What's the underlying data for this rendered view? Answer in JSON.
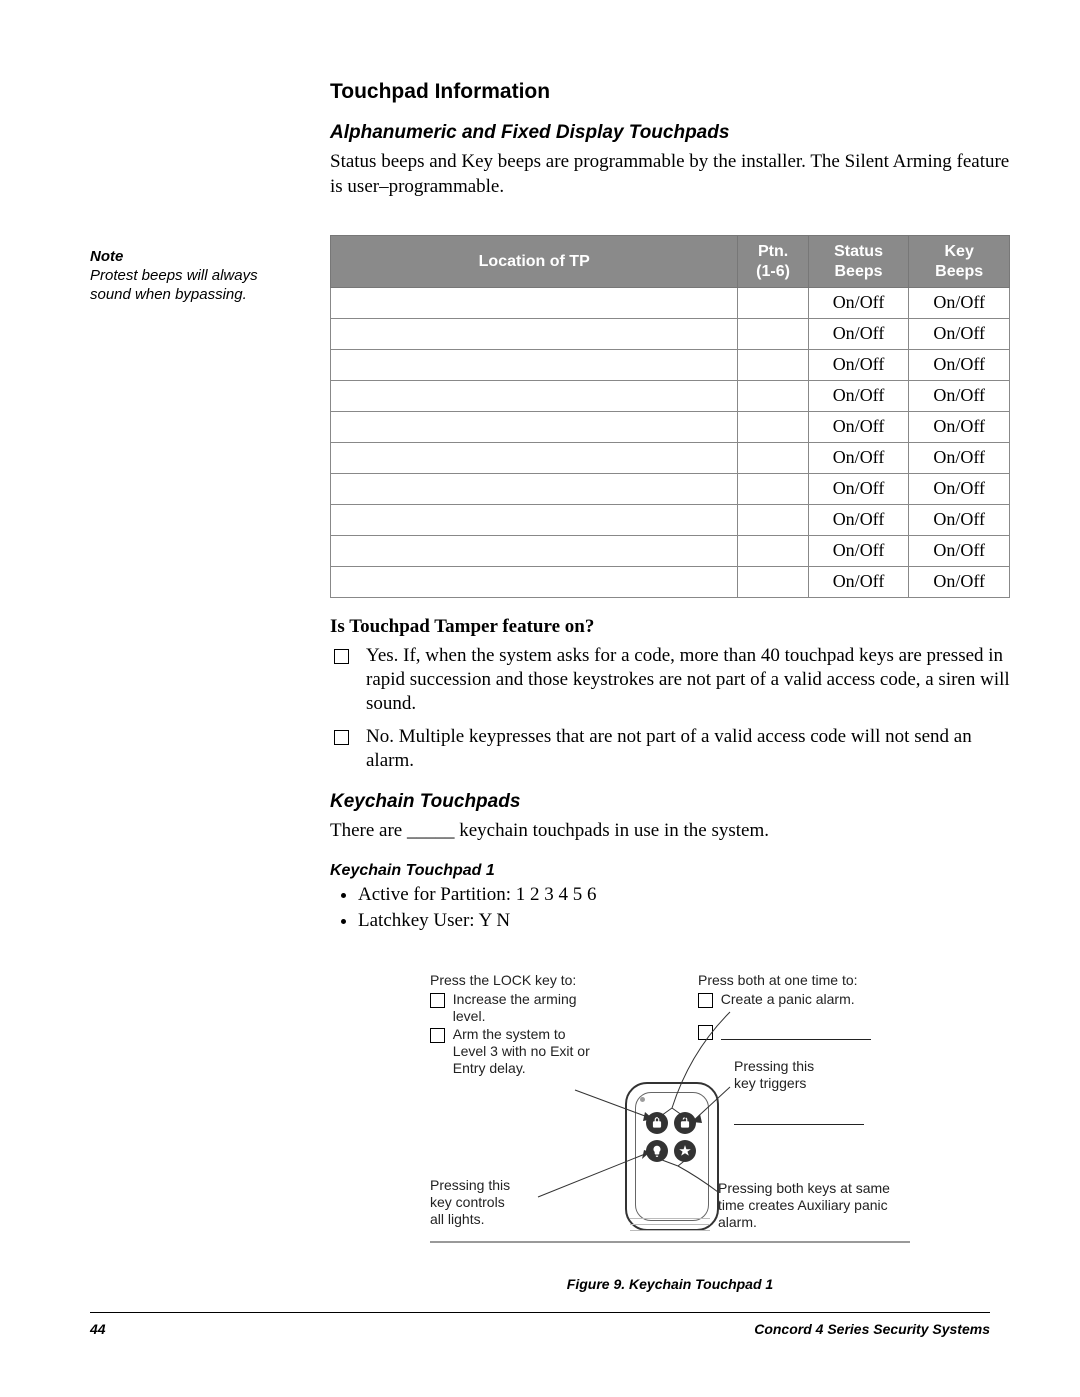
{
  "sidebar": {
    "note_head": "Note",
    "note_body": "Protest beeps will always sound when bypassing."
  },
  "section_title": "Touchpad Information",
  "sub1": {
    "heading": "Alphanumeric and Fixed Display Touchpads",
    "para": "Status beeps and Key beeps are programmable by the installer. The Silent Arming feature is user–programmable."
  },
  "table": {
    "headers": {
      "loc": "Location of TP",
      "ptn_l1": "Ptn.",
      "ptn_l2": "(1-6)",
      "status_l1": "Status",
      "status_l2": "Beeps",
      "key_l1": "Key",
      "key_l2": "Beeps"
    },
    "rows": [
      {
        "loc": "",
        "ptn": "",
        "status": "On/Off",
        "key": "On/Off"
      },
      {
        "loc": "",
        "ptn": "",
        "status": "On/Off",
        "key": "On/Off"
      },
      {
        "loc": "",
        "ptn": "",
        "status": "On/Off",
        "key": "On/Off"
      },
      {
        "loc": "",
        "ptn": "",
        "status": "On/Off",
        "key": "On/Off"
      },
      {
        "loc": "",
        "ptn": "",
        "status": "On/Off",
        "key": "On/Off"
      },
      {
        "loc": "",
        "ptn": "",
        "status": "On/Off",
        "key": "On/Off"
      },
      {
        "loc": "",
        "ptn": "",
        "status": "On/Off",
        "key": "On/Off"
      },
      {
        "loc": "",
        "ptn": "",
        "status": "On/Off",
        "key": "On/Off"
      },
      {
        "loc": "",
        "ptn": "",
        "status": "On/Off",
        "key": "On/Off"
      },
      {
        "loc": "",
        "ptn": "",
        "status": "On/Off",
        "key": "On/Off"
      }
    ]
  },
  "tamper": {
    "question": "Is Touchpad Tamper feature on?",
    "yes": "Yes.  If, when the system asks for a code, more than 40 touchpad keys are pressed in rapid succession and those keystrokes are not part of a valid access code, a siren will sound.",
    "no": "No.  Multiple keypresses that are not part of a valid access code will not send an alarm."
  },
  "keychain": {
    "heading": "Keychain Touchpads",
    "intro_a": "There are ",
    "intro_blank": "_____",
    "intro_b": " keychain touchpads in use in the system.",
    "kt1_head": "Keychain Touchpad 1",
    "bullet1": "Active for Partition: 1 2 3 4 5 6",
    "bullet2": "Latchkey User: Y   N"
  },
  "figure": {
    "lock_head": "Press the LOCK key to:",
    "lock_a": "Increase the arming level.",
    "lock_b": "Arm the system to Level 3 with no Exit or Entry delay.",
    "both_head": "Press both at one time to:",
    "both_a": "Create a panic alarm.",
    "trigger_a": "Pressing this",
    "trigger_b": "key triggers",
    "lights_a": "Pressing this",
    "lights_b": "key controls",
    "lights_c": "all lights.",
    "aux_a": "Pressing both keys at same",
    "aux_b": "time creates Auxiliary panic",
    "aux_c": "alarm.",
    "caption": "Figure 9. Keychain Touchpad 1"
  },
  "footer": {
    "page": "44",
    "title": "Concord  4 Series Security Systems"
  }
}
